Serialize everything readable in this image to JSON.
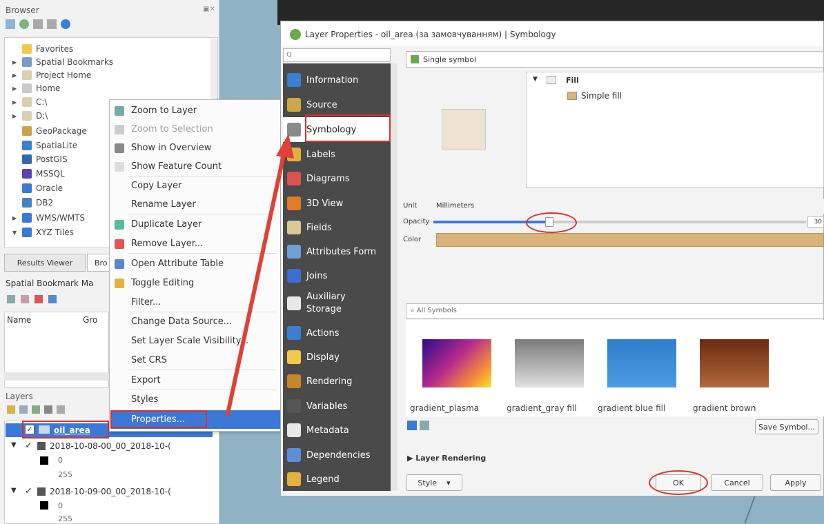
{
  "browser": {
    "title": "Browser",
    "items": [
      {
        "label": "Favorites",
        "icon": "star-icon"
      },
      {
        "label": "Spatial Bookmarks",
        "icon": "bookmark-icon"
      },
      {
        "label": "Project Home",
        "icon": "folder-icon"
      },
      {
        "label": "Home",
        "icon": "home-icon"
      },
      {
        "label": "C:\\",
        "icon": "folder-icon"
      },
      {
        "label": "D:\\",
        "icon": "folder-icon"
      },
      {
        "label": "GeoPackage",
        "icon": "geopackage-icon"
      },
      {
        "label": "SpatiaLite",
        "icon": "spatialite-icon"
      },
      {
        "label": "PostGIS",
        "icon": "postgis-icon"
      },
      {
        "label": "MSSQL",
        "icon": "mssql-icon"
      },
      {
        "label": "Oracle",
        "icon": "oracle-icon"
      },
      {
        "label": "DB2",
        "icon": "db2-icon"
      },
      {
        "label": "WMS/WMTS",
        "icon": "wms-icon"
      },
      {
        "label": "XYZ Tiles",
        "icon": "xyz-icon"
      }
    ]
  },
  "bottom_tabs": {
    "results_viewer": "Results Viewer",
    "browser_short": "Bro"
  },
  "bookmarks": {
    "title": "Spatial Bookmark Ma",
    "col_name": "Name",
    "col_group": "Gro"
  },
  "layers": {
    "title": "Layers",
    "items": [
      {
        "label": "oil_area"
      },
      {
        "label": "2018-10-08-00_00_2018-10-("
      },
      {
        "label": "2018-10-09-00_00_2018-10-("
      }
    ],
    "legend_values": [
      "0",
      "255",
      "0",
      "255"
    ]
  },
  "context_menu": {
    "items": [
      {
        "label": "Zoom to Layer",
        "disabled": false
      },
      {
        "label": "Zoom to Selection",
        "disabled": true
      },
      {
        "label": "Show in Overview",
        "disabled": false
      },
      {
        "label": "Show Feature Count",
        "disabled": false
      },
      {
        "label": "Copy Layer",
        "disabled": false
      },
      {
        "label": "Rename Layer",
        "disabled": false
      },
      {
        "label": "Duplicate Layer",
        "disabled": false
      },
      {
        "label": "Remove Layer...",
        "disabled": false
      },
      {
        "label": "Open Attribute Table",
        "disabled": false
      },
      {
        "label": "Toggle Editing",
        "disabled": false
      },
      {
        "label": "Filter...",
        "disabled": false
      },
      {
        "label": "Change Data Source...",
        "disabled": false
      },
      {
        "label": "Set Layer Scale Visibility...",
        "disabled": false
      },
      {
        "label": "Set CRS",
        "disabled": false
      },
      {
        "label": "Export",
        "disabled": false
      },
      {
        "label": "Styles",
        "disabled": false
      },
      {
        "label": "Properties...",
        "disabled": false
      }
    ]
  },
  "dialog": {
    "title": "Layer Properties - oil_area (за замовчуванням) | Symbology",
    "search_placeholder": "Q",
    "nav": [
      {
        "label": "Information",
        "color": "#3b7fd1"
      },
      {
        "label": "Source",
        "color": "#cfa64a"
      },
      {
        "label": "Symbology",
        "color": "#8a8a8a"
      },
      {
        "label": "Labels",
        "color": "#e3b23c"
      },
      {
        "label": "Diagrams",
        "color": "#d9534f"
      },
      {
        "label": "3D View",
        "color": "#e07b2a"
      },
      {
        "label": "Fields",
        "color": "#d8c89a"
      },
      {
        "label": "Attributes Form",
        "color": "#6fa0d8"
      },
      {
        "label": "Joins",
        "color": "#3b6fd1"
      },
      {
        "label": "Auxiliary Storage",
        "color": "#e8e8e8"
      },
      {
        "label": "Actions",
        "color": "#3b7fd1"
      },
      {
        "label": "Display",
        "color": "#f2c94c"
      },
      {
        "label": "Rendering",
        "color": "#c8862a"
      },
      {
        "label": "Variables",
        "color": "#555555"
      },
      {
        "label": "Metadata",
        "color": "#e8e8e8"
      },
      {
        "label": "Dependencies",
        "color": "#5b8fd6"
      },
      {
        "label": "Legend",
        "color": "#e3b23c"
      }
    ],
    "renderer": "Single symbol",
    "symbol_tree": {
      "fill": "Fill",
      "simple_fill": "Simple fill"
    },
    "unit_label": "Unit",
    "unit_value": "Millimeters",
    "opacity_label": "Opacity",
    "opacity_value": "30",
    "color_label": "Color",
    "fill_color": "#d9b37a",
    "preview_color": "#eee2d2",
    "symbols_search": "All Symbols",
    "symbols": [
      {
        "label": "gradient_plasma"
      },
      {
        "label": "gradient_gray fill"
      },
      {
        "label": "gradient blue fill"
      },
      {
        "label": "gradient brown"
      }
    ],
    "save_symbol": "Save Symbol...",
    "layer_rendering": "Layer Rendering",
    "style_btn": "Style",
    "ok": "OK",
    "cancel": "Cancel",
    "apply": "Apply"
  }
}
